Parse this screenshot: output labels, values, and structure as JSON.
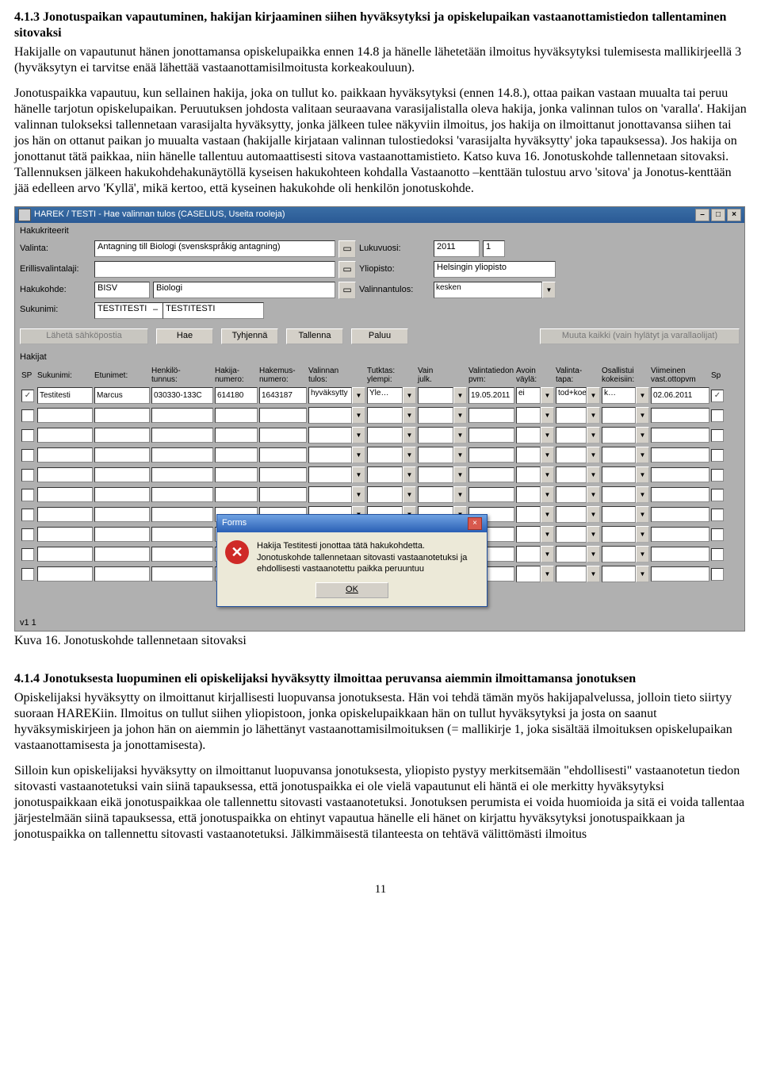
{
  "section1": {
    "heading": "4.1.3 Jonotuspaikan vapautuminen, hakijan kirjaaminen siihen hyväksytyksi ja opiskelupaikan vastaanottamistiedon tallentaminen sitovaksi",
    "p1": "Hakijalle on vapautunut hänen jonottamansa opiskelupaikka ennen 14.8 ja hänelle lähetetään ilmoitus hyväksytyksi tulemisesta mallikirjeellä 3 (hyväksytyn ei tarvitse enää lähettää vastaanottamisilmoitusta korkeakouluun).",
    "p2": "Jonotuspaikka vapautuu, kun sellainen hakija, joka on tullut ko. paikkaan hyväksytyksi (ennen 14.8.), ottaa paikan vastaan muualta tai peruu hänelle tarjotun opiskelupaikan. Peruutuksen johdosta valitaan seuraavana varasijalistalla oleva hakija, jonka valinnan tulos on 'varalla'. Hakijan valinnan tulokseksi tallennetaan varasijalta hyväksytty, jonka jälkeen tulee näkyviin ilmoitus, jos hakija on ilmoittanut jonottavansa siihen tai jos hän on ottanut paikan jo muualta vastaan (hakijalle kirjataan valinnan tulostiedoksi 'varasijalta hyväksytty' joka tapauksessa). Jos hakija on jonottanut tätä paikkaa, niin hänelle tallentuu automaattisesti sitova vastaanottamistieto. Katso kuva 16. Jonotuskohde tallennetaan sitovaksi.  Tallennuksen jälkeen hakukohdehakunäytöllä kyseisen hakukohteen kohdalla Vastaanotto –kenttään tulostuu arvo 'sitova' ja Jonotus-kenttään jää edelleen arvo 'Kyllä', mikä kertoo, että kyseinen hakukohde oli henkilön jonotuskohde."
  },
  "window": {
    "title": "HAREK / TESTI - Hae valinnan tulos  (CASELIUS, Useita rooleja)",
    "group_labels": {
      "criteria": "Hakukriteerit",
      "applicants": "Hakijat"
    },
    "labels": {
      "valinta": "Valinta:",
      "erillis": "Erillisvalintalaji:",
      "hakukohde": "Hakukohde:",
      "sukunimi": "Sukunimi:",
      "lukuvuosi": "Lukuvuosi:",
      "yliopisto": "Yliopisto:",
      "valinnantulos": "Valinnantulos:"
    },
    "values": {
      "valinta": "Antagning till Biologi (svenskspråkig antagning)",
      "hakukohde_code": "BISV",
      "hakukohde_name": "Biologi",
      "sukunimi_from": "TESTITESTI",
      "sukunimi_to": "TESTITESTI",
      "lukuvuosi": "2011",
      "lukuvuosi_n": "1",
      "yliopisto": "Helsingin yliopisto",
      "valinnantulos": "kesken"
    },
    "buttons": {
      "email": "Lähetä sähköpostia",
      "hae": "Hae",
      "tyhjenna": "Tyhjennä",
      "tallenna": "Tallenna",
      "paluu": "Paluu",
      "muuta_kaikki": "Muuta kaikki (vain hylätyt ja varallaolijat)"
    },
    "columns": [
      "SP",
      "Sukunimi:",
      "Etunimet:",
      "Henkilö-\ntunnus:",
      "Hakija-\nnumero:",
      "Hakemus-\nnumero:",
      "Valinnan\ntulos:",
      "Tutktas:\nylempi:",
      "Vain\njulk.",
      "Valintatiedon\npvm:",
      "Avoin\nväylä:",
      "Valinta-\ntapa:",
      "Osallistui\nkokeisiin:",
      "Viimeinen\nvast.ottopvm",
      "Sp"
    ],
    "row1": {
      "sukunimi": "Testitesti",
      "etunimet": "Marcus",
      "hetu": "030330-133C",
      "hakijanro": "614180",
      "hakemusnro": "1643187",
      "valtulos": "hyväksytty",
      "tutktas": "Yle…",
      "vainjulk": "",
      "valpvm": "19.05.2011",
      "avoin": "ei",
      "valtapa": "tod+koe",
      "osallistui": "k…",
      "viimeinen": "02.06.2011"
    },
    "dialog": {
      "title": "Forms",
      "text": "Hakija Testitesti jonottaa tätä hakukohdetta. Jonotuskohde tallennetaan sitovasti vastaanotetuksi ja ehdollisesti vastaanotettu paikka peruuntuu",
      "ok": "OK"
    },
    "version": "v1 1"
  },
  "caption": "Kuva 16. Jonotuskohde tallennetaan sitovaksi",
  "section2": {
    "heading": "4.1.4 Jonotuksesta luopuminen eli opiskelijaksi hyväksytty ilmoittaa peruvansa aiemmin ilmoittamansa jonotuksen",
    "p1": "Opiskelijaksi hyväksytty on ilmoittanut kirjallisesti luopuvansa jonotuksesta. Hän voi tehdä tämän myös hakijapalvelussa, jolloin tieto siirtyy suoraan HAREKiin. Ilmoitus on tullut siihen yliopistoon, jonka opiskelupaikkaan hän on tullut hyväksytyksi ja josta on saanut hyväksymiskirjeen ja johon hän on aiemmin jo lähettänyt vastaanottamisilmoituksen (= mallikirje 1, joka sisältää ilmoituksen opiskelupaikan vastaanottamisesta ja jonottamisesta).",
    "p2": "Silloin kun opiskelijaksi hyväksytty on ilmoittanut luopuvansa jonotuksesta, yliopisto pystyy merkitsemään \"ehdollisesti\" vastaanotetun tiedon sitovasti vastaanotetuksi vain siinä tapauksessa, että jonotuspaikka ei ole vielä vapautunut eli häntä ei ole merkitty hyväksytyksi jonotuspaikkaan eikä jonotuspaikkaa ole tallennettu sitovasti vastaanotetuksi. Jonotuksen perumista ei voida huomioida ja sitä ei voida tallentaa järjestelmään siinä tapauksessa, että jonotuspaikka on ehtinyt vapautua hänelle eli hänet on kirjattu hyväksytyksi jonotuspaikkaan ja jonotuspaikka on tallennettu sitovasti vastaanotetuksi. Jälkimmäisestä tilanteesta on tehtävä välittömästi ilmoitus"
  },
  "page_number": "11"
}
